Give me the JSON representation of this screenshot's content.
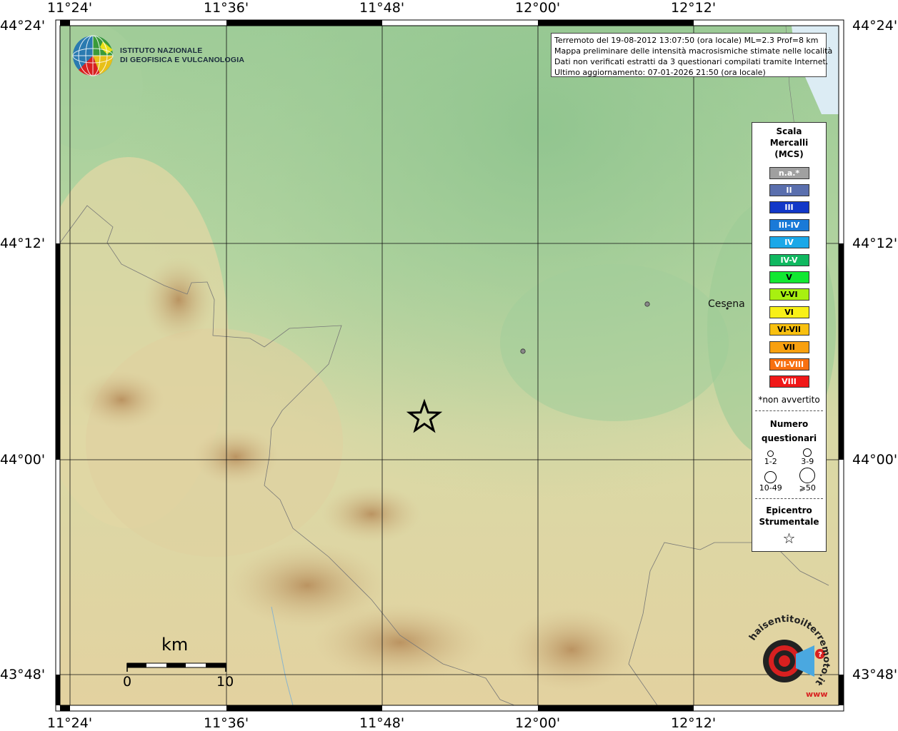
{
  "map": {
    "lon_ticks": [
      "11°24'",
      "11°36'",
      "11°48'",
      "12°00'",
      "12°12'"
    ],
    "lat_ticks": [
      "44°24'",
      "44°12'",
      "44°00'",
      "43°48'"
    ]
  },
  "info": {
    "line1": "Terremoto del 19-08-2012 13:07:50 (ora locale) ML=2.3 Prof=8 km",
    "line2": "Mappa preliminare delle intensità macrosismiche stimate nelle località",
    "line3": "Dati non verificati estratti da 3 questionari compilati tramite Internet.",
    "line4": "Ultimo aggiornamento: 07-01-2026 21:50 (ora locale)"
  },
  "logo": {
    "line1": "ISTITUTO NAZIONALE",
    "line2": "DI GEOFISICA E VULCANOLOGIA",
    "icon": "ingv-globe-icon"
  },
  "legend": {
    "title1": "Scala",
    "title2": "Mercalli",
    "title3": "(MCS)",
    "scale": [
      {
        "label": "n.a.*",
        "color": "#a0a0a0"
      },
      {
        "label": "II",
        "color": "#5a6fae"
      },
      {
        "label": "III",
        "color": "#1238c8"
      },
      {
        "label": "III-IV",
        "color": "#1a7ad8"
      },
      {
        "label": "IV",
        "color": "#1aa8e8"
      },
      {
        "label": "IV-V",
        "color": "#10b860"
      },
      {
        "label": "V",
        "color": "#12e832"
      },
      {
        "label": "V-VI",
        "color": "#a8f010"
      },
      {
        "label": "VI",
        "color": "#f8f018"
      },
      {
        "label": "VI-VII",
        "color": "#f8c010"
      },
      {
        "label": "VII",
        "color": "#f8a010"
      },
      {
        "label": "VII-VIII",
        "color": "#f87010"
      },
      {
        "label": "VIII",
        "color": "#f01818"
      }
    ],
    "note": "*non avvertito",
    "count_title1": "Numero",
    "count_title2": "questionari",
    "count_labels": [
      "1-2",
      "3-9",
      "10-49",
      "⩾50"
    ],
    "epi_title1": "Epicentro",
    "epi_title2": "Strumentale",
    "epi_symbol": "☆"
  },
  "places": {
    "cesena": "Cesena"
  },
  "scale_bar": {
    "unit": "km",
    "start": "0",
    "end": "10"
  },
  "badge": {
    "text": "haisentitoilterremoto.it",
    "url": "www"
  }
}
